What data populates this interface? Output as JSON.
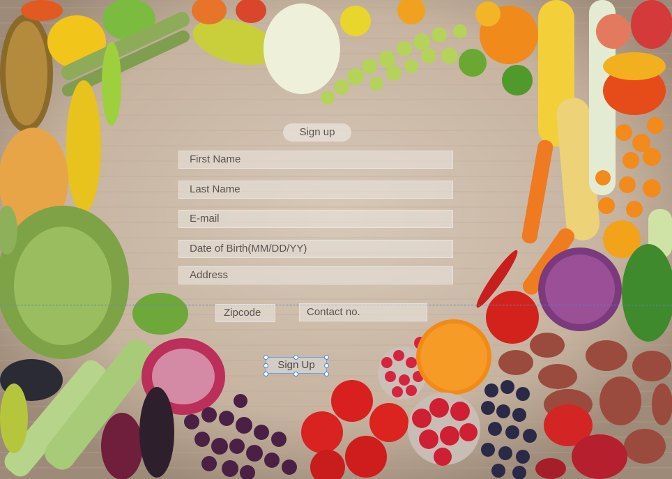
{
  "background_description_icon": "vegetables-heart-wood-background",
  "form": {
    "title": "Sign up",
    "fields": {
      "first_name": "First Name",
      "last_name": "Last Name",
      "email": "E-mail",
      "dob": "Date of Birth(MM/DD/YY)",
      "address": "Address",
      "zipcode": "Zipcode",
      "contact": "Contact no."
    },
    "submit_label": "Sign Up"
  },
  "colors": {
    "wood": "#c9b7a5",
    "selection": "#4a88d4"
  }
}
